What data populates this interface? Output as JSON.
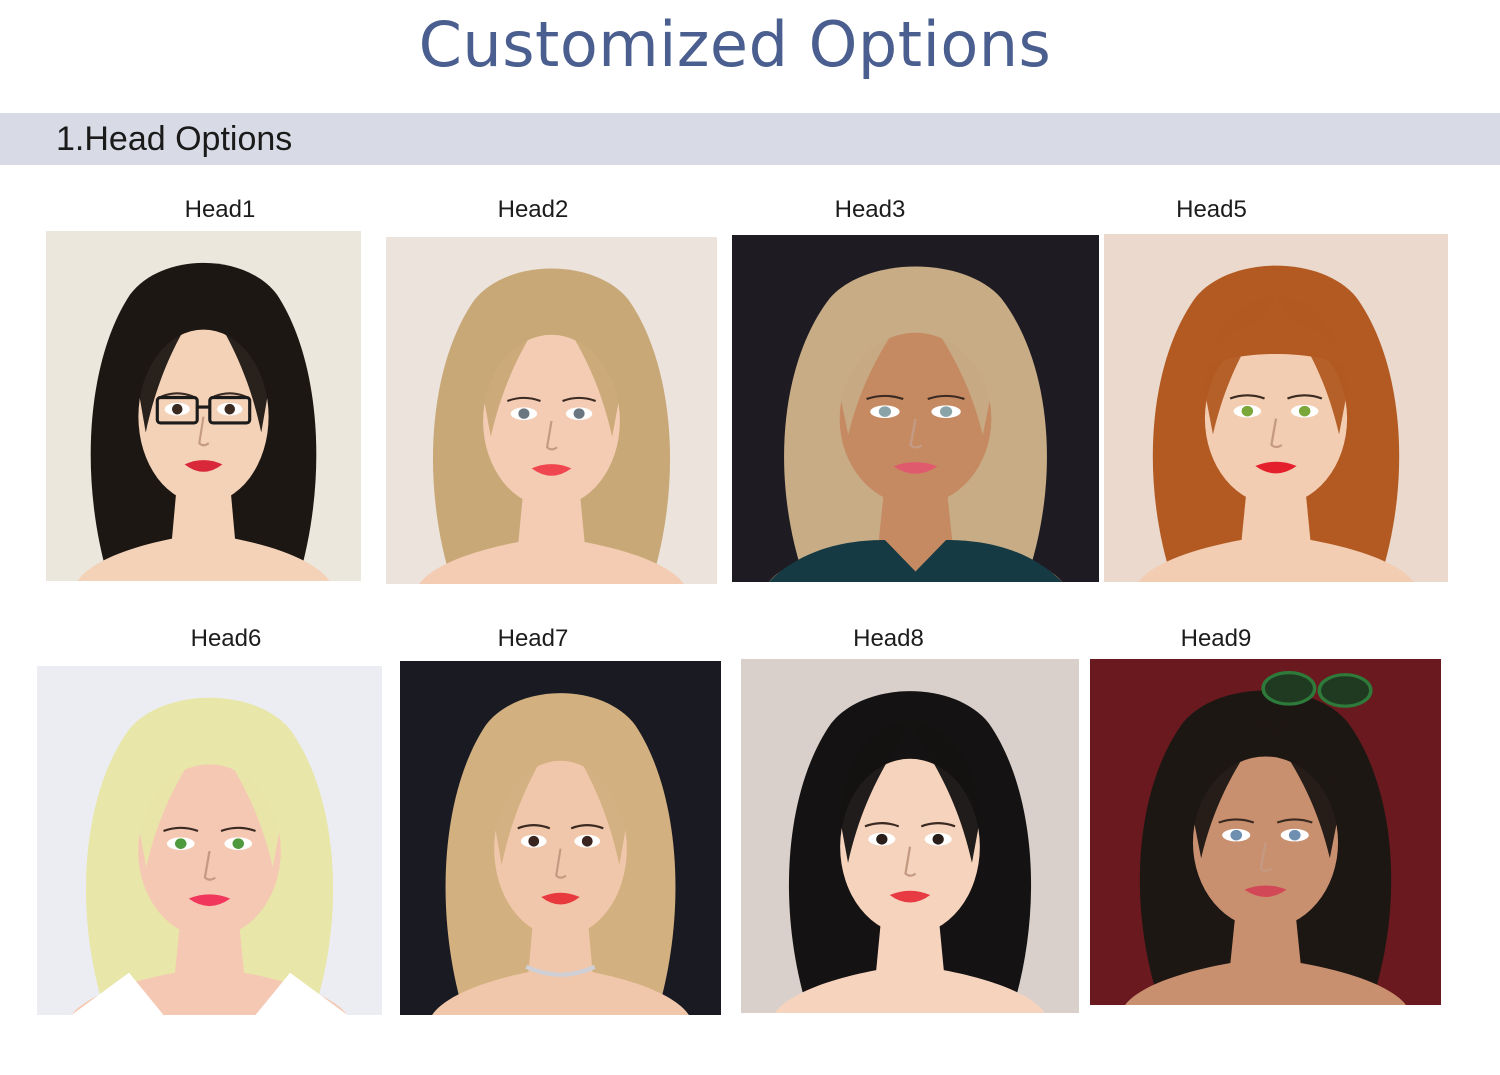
{
  "page": {
    "title": "Customized Options",
    "section_title": "1.Head Options"
  },
  "heads": [
    {
      "label": "Head1",
      "hair": "#1c1713",
      "bg": "#ece7dd",
      "skin": "#f4d2b8",
      "eyes": "#3a2a20",
      "lips": "#d8283a",
      "accessory": "glasses"
    },
    {
      "label": "Head2",
      "hair": "#c9a877",
      "bg": "#ebe3dc",
      "skin": "#f3ccb3",
      "eyes": "#6b7780",
      "lips": "#f0464f",
      "accessory": "none"
    },
    {
      "label": "Head3",
      "hair": "#c7ac86",
      "bg": "#1e1b22",
      "skin": "#c58a62",
      "eyes": "#8aa3a8",
      "lips": "#e05a6e",
      "accessory": "lace-top"
    },
    {
      "label": "Head5",
      "hair": "#b25a22",
      "bg": "#ead9cc",
      "skin": "#f2cdb2",
      "eyes": "#7aa63a",
      "lips": "#e5202d",
      "accessory": "bangs"
    },
    {
      "label": "Head6",
      "hair": "#e8e6a8",
      "bg": "#ecedf2",
      "skin": "#f5c8b4",
      "eyes": "#4f9a3c",
      "lips": "#f1385c",
      "accessory": "collar"
    },
    {
      "label": "Head7",
      "hair": "#d2b080",
      "bg": "#1a1a22",
      "skin": "#f0c7aa",
      "eyes": "#3a2420",
      "lips": "#e8393f",
      "accessory": "necklace"
    },
    {
      "label": "Head8",
      "hair": "#141212",
      "bg": "#d9cfcb",
      "skin": "#f6d3bd",
      "eyes": "#2a1e1a",
      "lips": "#e83a42",
      "accessory": "none"
    },
    {
      "label": "Head9",
      "hair": "#1d1714",
      "bg": "#6a1a1e",
      "skin": "#c99070",
      "eyes": "#6f8fb0",
      "lips": "#d34856",
      "accessory": "sunglasses"
    }
  ]
}
